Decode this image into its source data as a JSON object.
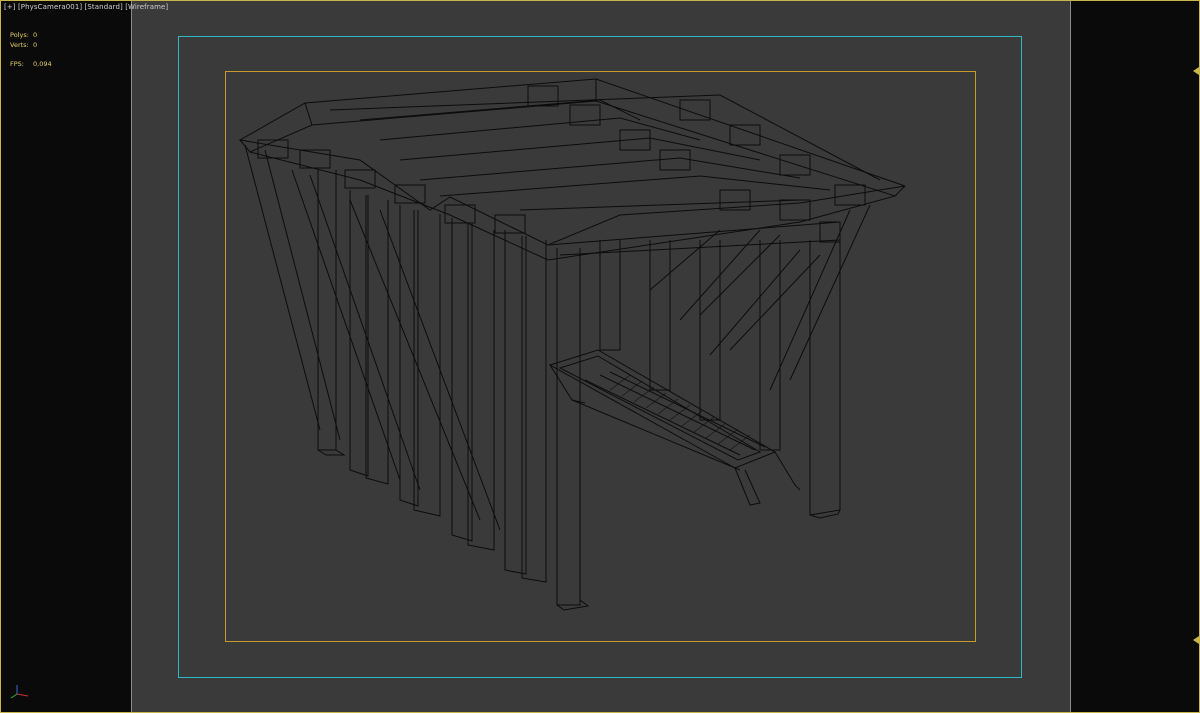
{
  "viewport": {
    "label_plus": "[+]",
    "label_camera": "[PhysCamera001]",
    "label_shading": "[Standard]",
    "label_mode": "[Wireframe]"
  },
  "stats": {
    "polys_label": "Polys:",
    "polys_value": "0",
    "verts_label": "Verts:",
    "verts_value": "0",
    "fps_label": "FPS:",
    "fps_value": "0,094"
  },
  "colors": {
    "viewport_border": "#c9b64a",
    "action_safe": "#2fb6c6",
    "title_safe": "#c79a2c",
    "background": "#3a3a3a",
    "wire": "#0c0c0c"
  },
  "icons": {
    "axis_gizmo": "xyz-axis-icon",
    "side_arrows": "triangle-left-icon"
  }
}
